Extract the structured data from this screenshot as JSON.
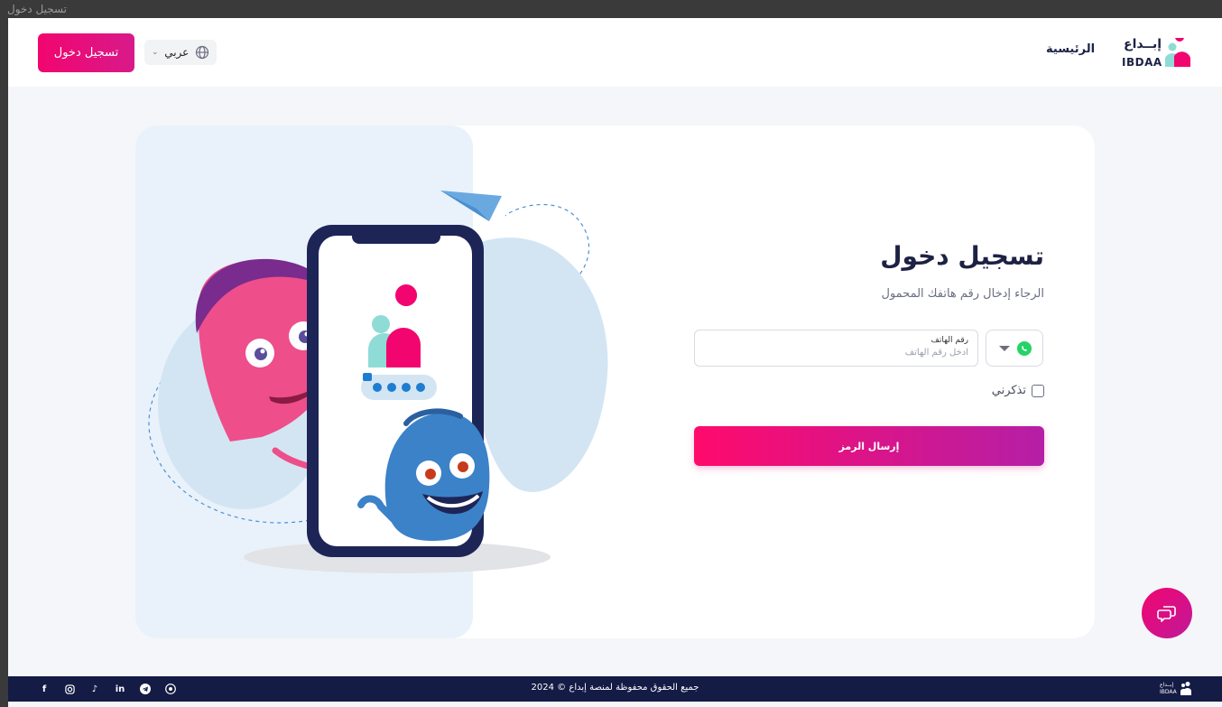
{
  "window": {
    "title": "تسجيل دخول"
  },
  "header": {
    "login_button": "تسجيل دخول",
    "language": "عربي",
    "home_link": "الرئيسية",
    "logo_ar": "إبــداع",
    "logo_en": "IBDAA"
  },
  "form": {
    "title": "تسجيل دخول",
    "subtitle": "الرجاء إدخال رقم هاتفك المحمول",
    "phone_label": "رقم الهاتف",
    "phone_placeholder": "ادخل رقم الهاتف",
    "phone_value": "",
    "remember_label": "تذكرني",
    "remember_checked": false,
    "send_button": "إرسال الرمز"
  },
  "footer": {
    "copyright": "جميع الحقوق محفوظة لمنصة إبداع © 2024",
    "logo_text": "إبــداع",
    "logo_en": "IBDAA",
    "socials": [
      "facebook-icon",
      "instagram-icon",
      "tiktok-icon",
      "linkedin-icon",
      "telegram-icon",
      "whatsapp-icon"
    ]
  },
  "colors": {
    "brand_pink": "#f2056f",
    "brand_purple": "#b51fa6",
    "navy": "#141b45",
    "teal": "#8fdcd6",
    "whatsapp": "#25d366"
  }
}
